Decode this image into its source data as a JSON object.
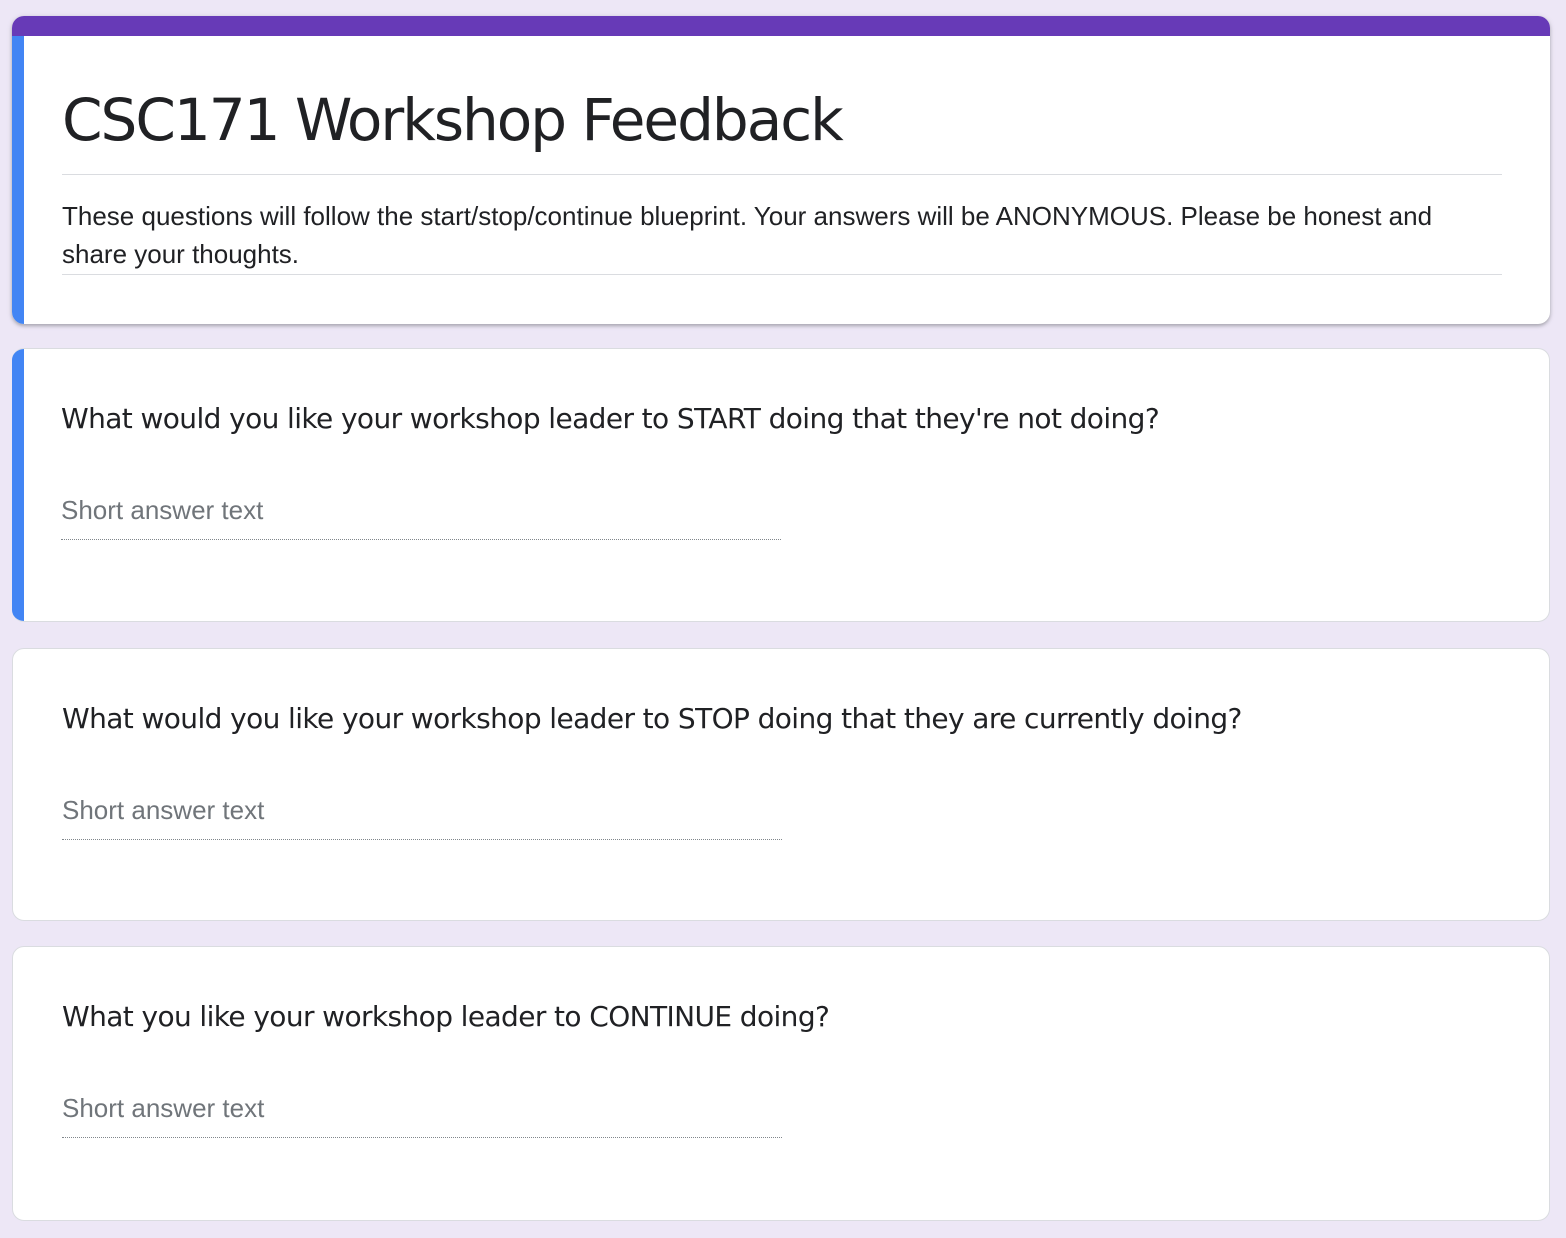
{
  "form": {
    "title": "CSC171 Workshop Feedback",
    "description": "These questions will follow the start/stop/continue blueprint. Your answers will be ANONYMOUS. Please be honest and share your thoughts."
  },
  "questions": [
    {
      "title": "What would you like your workshop leader to START doing that they're not doing?",
      "placeholder": "Short answer text"
    },
    {
      "title": "What would you like your workshop leader to STOP doing that they are currently doing?",
      "placeholder": "Short answer text"
    },
    {
      "title": "What you like your workshop leader to CONTINUE doing?",
      "placeholder": "Short answer text"
    }
  ],
  "colors": {
    "theme": "#673ab7",
    "active_indicator": "#4285f4",
    "background": "#ede7f6"
  }
}
